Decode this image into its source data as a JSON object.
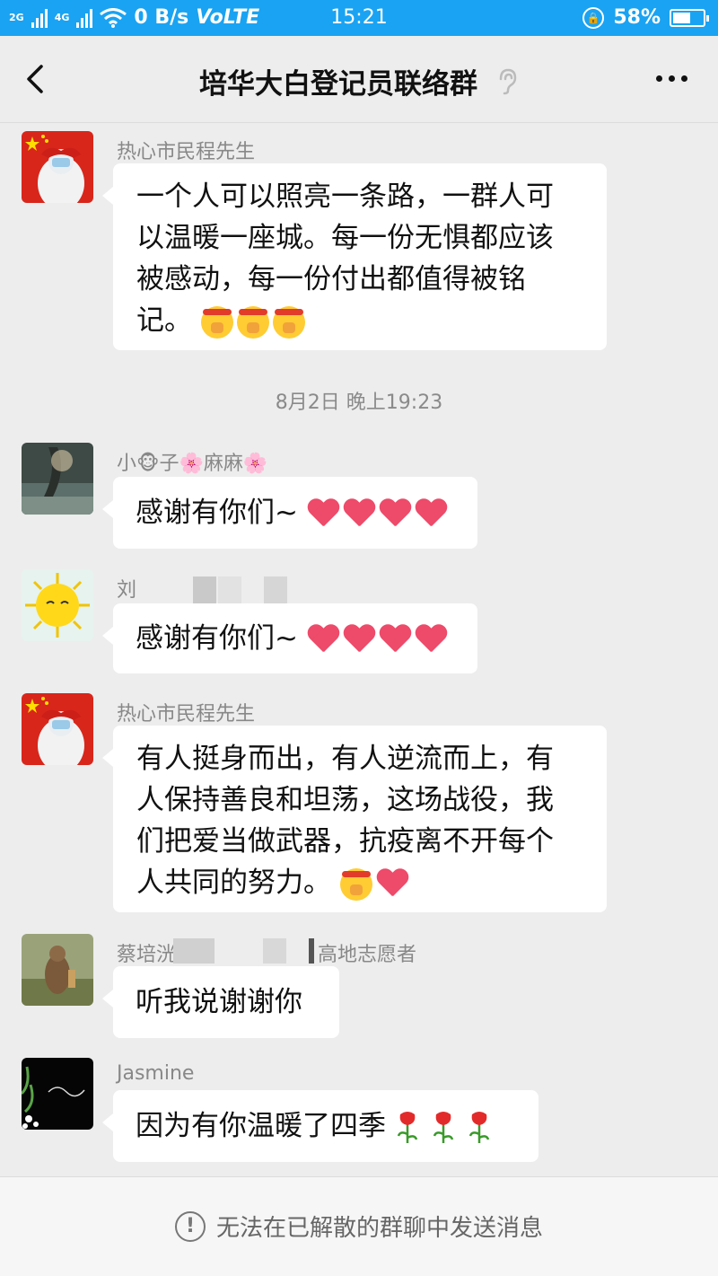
{
  "status_bar": {
    "network_left": "2G",
    "network_right": "4G",
    "speed": "0 B/s",
    "volte": "VoLTE",
    "time": "15:21",
    "battery_percent": "58%",
    "battery_level": 0.58
  },
  "header": {
    "title": "培华大白登记员联络群",
    "back_icon": "chevron-left-icon",
    "mute_icon": "ear-icon",
    "more_icon": "more-dots-icon"
  },
  "messages": [
    {
      "sender": "热心市民程先生",
      "text_lines": [
        "一个人可以照亮一条路，一群人可",
        "以温暖一座城。每一份无惧都应该",
        "被感动，每一份付出都值得被铭",
        "记。"
      ],
      "emojis": [
        "salute-face",
        "salute-face",
        "salute-face"
      ]
    },
    {
      "timestamp": "8月2日 晚上19:23"
    },
    {
      "sender": "小🐵子🌸麻麻🌸",
      "text": "感谢有你们~",
      "emojis": [
        "heart",
        "heart",
        "heart",
        "heart"
      ]
    },
    {
      "sender": "刘",
      "text": "感谢有你们~",
      "emojis": [
        "heart",
        "heart",
        "heart",
        "heart"
      ]
    },
    {
      "sender": "热心市民程先生",
      "text_lines": [
        "有人挺身而出，有人逆流而上，有",
        "人保持善良和坦荡，这场战役，我",
        "们把爱当做武器，抗疫离不开每个",
        "人共同的努力。"
      ],
      "emojis": [
        "salute-face",
        "heart"
      ]
    },
    {
      "sender_prefix": "蔡培洸",
      "sender_suffix": "高地志愿者",
      "text": "听我说谢谢你"
    },
    {
      "sender": "Jasmine",
      "text": "因为有你温暖了四季",
      "emojis": [
        "rose",
        "rose",
        "rose"
      ]
    }
  ],
  "footer": {
    "notice": "无法在已解散的群聊中发送消息",
    "icon": "info-icon"
  }
}
